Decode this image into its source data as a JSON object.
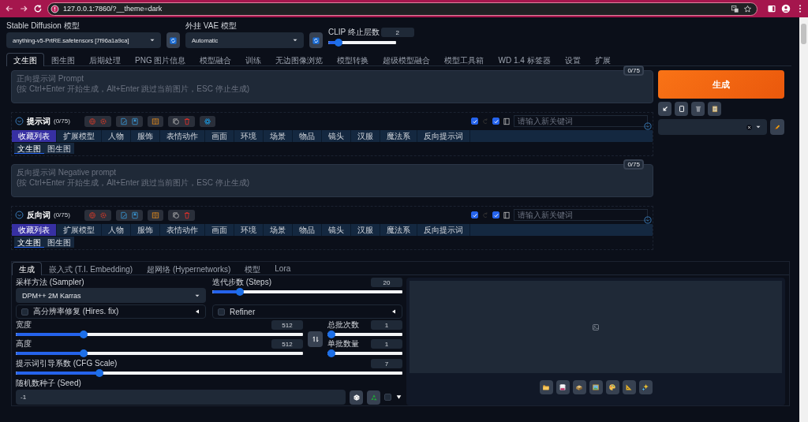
{
  "browser": {
    "address": "127.0.0.1:7860/?__theme=dark"
  },
  "model_settings": {
    "checkpoint": {
      "label": "Stable Diffusion 模型",
      "value": "anything-v5-PrtRE.safetensors [7f96a1a9ca]"
    },
    "vae": {
      "label": "外挂 VAE 模型",
      "value": "Automatic"
    },
    "clip_skip": {
      "label": "CLIP 终止层数",
      "value": "2",
      "level": 0.1
    }
  },
  "main_tabs": [
    {
      "label": "文生图",
      "selected": true
    },
    {
      "label": "图生图",
      "selected": false
    },
    {
      "label": "后期处理",
      "selected": false
    },
    {
      "label": "PNG 图片信息",
      "selected": false
    },
    {
      "label": "模型融合",
      "selected": false
    },
    {
      "label": "训练",
      "selected": false
    },
    {
      "label": "无边图像浏览",
      "selected": false
    },
    {
      "label": "模型转换",
      "selected": false
    },
    {
      "label": "超级模型融合",
      "selected": false
    },
    {
      "label": "模型工具箱",
      "selected": false
    },
    {
      "label": "WD 1.4 标签器",
      "selected": false
    },
    {
      "label": "设置",
      "selected": false
    },
    {
      "label": "扩展",
      "selected": false
    }
  ],
  "prompts": [
    {
      "placeholder": "正向提示词 Prompt\n(按 Ctrl+Enter 开始生成，Alt+Enter 跳过当前图片，ESC 停止生成)",
      "counter": "0/75",
      "helper": {
        "title": "提示词",
        "count": "(0/75)",
        "settings_button": true,
        "checkboxes": [
          {
            "checked": true
          },
          {
            "checked": true
          }
        ],
        "keyword_placeholder": "请输入新关键词",
        "categories": [
          {
            "label": "收藏列表",
            "selected": true
          },
          {
            "label": "扩展模型",
            "selected": false
          },
          {
            "label": "人物",
            "selected": false
          },
          {
            "label": "服饰",
            "selected": false
          },
          {
            "label": "表情动作",
            "selected": false
          },
          {
            "label": "画面",
            "selected": false
          },
          {
            "label": "环境",
            "selected": false
          },
          {
            "label": "场景",
            "selected": false
          },
          {
            "label": "物品",
            "selected": false
          },
          {
            "label": "镜头",
            "selected": false
          },
          {
            "label": "汉服",
            "selected": false
          },
          {
            "label": "魔法系",
            "selected": false
          },
          {
            "label": "反向提示词",
            "selected": false
          }
        ],
        "modes": [
          {
            "label": "文生图",
            "selected": true
          },
          {
            "label": "图生图",
            "selected": false
          }
        ]
      }
    },
    {
      "placeholder": "反向提示词 Negative prompt\n(按 Ctrl+Enter 开始生成，Alt+Enter 跳过当前图片，ESC 停止生成)",
      "counter": "0/75",
      "helper": {
        "title": "反向词",
        "count": "(0/75)",
        "settings_button": false,
        "checkboxes": [
          {
            "checked": true
          },
          {
            "checked": true
          }
        ],
        "keyword_placeholder": "请输入新关键词",
        "categories": [
          {
            "label": "收藏列表",
            "selected": true
          },
          {
            "label": "扩展模型",
            "selected": false
          },
          {
            "label": "人物",
            "selected": false
          },
          {
            "label": "服饰",
            "selected": false
          },
          {
            "label": "表情动作",
            "selected": false
          },
          {
            "label": "画面",
            "selected": false
          },
          {
            "label": "环境",
            "selected": false
          },
          {
            "label": "场景",
            "selected": false
          },
          {
            "label": "物品",
            "selected": false
          },
          {
            "label": "镜头",
            "selected": false
          },
          {
            "label": "汉服",
            "selected": false
          },
          {
            "label": "魔法系",
            "selected": false
          },
          {
            "label": "反向提示词",
            "selected": false
          }
        ],
        "modes": [
          {
            "label": "文生图",
            "selected": true
          },
          {
            "label": "图生图",
            "selected": false
          }
        ]
      }
    }
  ],
  "actions": {
    "generate": "生成"
  },
  "inner_tabs": [
    {
      "label": "生成",
      "selected": true
    },
    {
      "label": "嵌入式 (T.I. Embedding)",
      "selected": false
    },
    {
      "label": "超网络 (Hypernetworks)",
      "selected": false
    },
    {
      "label": "模型",
      "selected": false
    },
    {
      "label": "Lora",
      "selected": false
    }
  ],
  "settings": {
    "sampler": {
      "label": "采样方法 (Sampler)",
      "value": "DPM++ 2M Karras"
    },
    "steps": {
      "label": "迭代步数 (Steps)",
      "value": "20",
      "level": 0.13
    },
    "accordions": [
      {
        "label": "高分辨率修复 (Hires. fix)",
        "checked": false
      },
      {
        "label": "Refiner",
        "checked": false
      }
    ],
    "width": {
      "label": "宽度",
      "value": "512",
      "level": 0.23
    },
    "height": {
      "label": "高度",
      "value": "512",
      "level": 0.23
    },
    "batch_count": {
      "label": "总批次数",
      "value": "1",
      "level": 0
    },
    "batch_size": {
      "label": "单批数量",
      "value": "1",
      "level": 0
    },
    "cfg_scale": {
      "label": "提示词引导系数 (CFG Scale)",
      "value": "7",
      "level": 0.21
    },
    "seed": {
      "label": "随机数种子 (Seed)",
      "value": "-1",
      "extra_checked": false
    }
  }
}
